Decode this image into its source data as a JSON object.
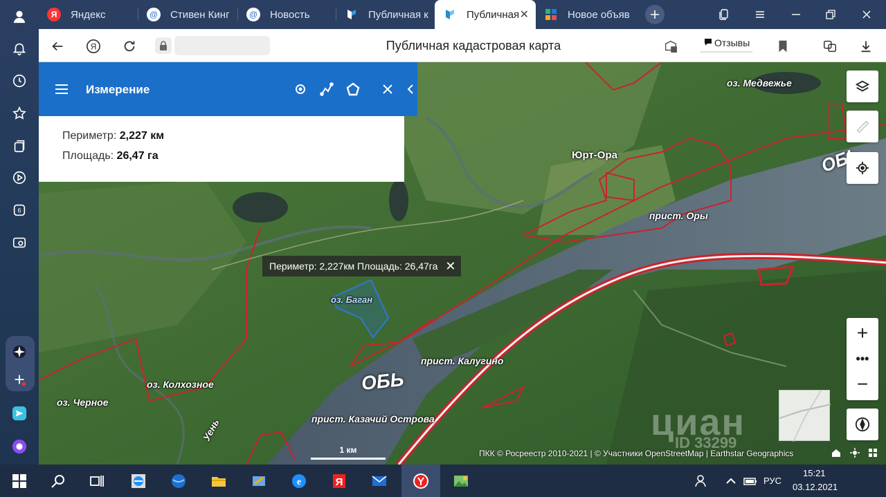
{
  "tabs": [
    {
      "label": "Яндекс",
      "favicon": "Я",
      "color": "#f33"
    },
    {
      "label": "Стивен Кинг",
      "favicon": "@",
      "color": "#3a7bd5"
    },
    {
      "label": "Новость",
      "favicon": "@",
      "color": "#3a7bd5"
    },
    {
      "label": "Публичная к",
      "favicon": "",
      "color": "#2b3f63"
    },
    {
      "label": "Публичная",
      "favicon": "",
      "color": "#fff",
      "active": true
    },
    {
      "label": "Новое объяв",
      "favicon": "",
      "color": "#2b3f63"
    }
  ],
  "address_bar": {
    "title": "Публичная кадастровая карта",
    "reviews": "Отзывы"
  },
  "measure": {
    "title": "Измерение",
    "perimeter_label": "Периметр:",
    "perimeter_value": "2,227 км",
    "area_label": "Площадь:",
    "area_value": "26,47 га"
  },
  "map": {
    "tooltip": "Периметр: 2,227км Площадь: 26,47га",
    "labels": {
      "yurt_ora": "Юрт-Ора",
      "lake_medvezhye": "оз. Медвежье",
      "prist_ory": "прист. Оры",
      "ob_top": "ОБЬ",
      "ob_main": "ОБЬ",
      "lake_bagan": "оз. Баган",
      "prist_kalugino": "прист. Калугино",
      "lake_kolkhoznoe": "оз. Колхозное",
      "lake_chernoe": "оз. Черное",
      "prist_kazachy": "прист. Казачий Острова",
      "uen": "Уень"
    },
    "scale": "1 км",
    "attribution": "ПКК © Росреестр 2010-2021 | © Участники OpenStreetMap | Earthstar Geographics",
    "watermark": "циан",
    "watermark_id": "ID 33299"
  },
  "taskbar": {
    "lang": "РУС",
    "time": "15:21",
    "date": "03.12.2021"
  }
}
